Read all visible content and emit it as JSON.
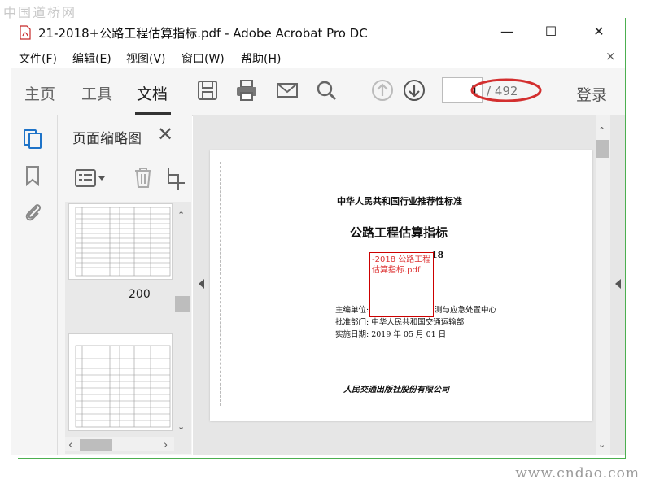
{
  "watermarks": {
    "top": "中国道桥网",
    "bottom": "www.cndao.com"
  },
  "window": {
    "title": "21-2018+公路工程估算指标.pdf - Adobe Acrobat Pro DC"
  },
  "window_buttons": {
    "minimize": "—",
    "maximize": "☐",
    "close": "✕"
  },
  "menu": {
    "items": [
      "文件(F)",
      "编辑(E)",
      "视图(V)",
      "窗口(W)",
      "帮助(H)"
    ],
    "close": "×"
  },
  "toolbar": {
    "tabs": [
      "主页",
      "工具",
      "文档"
    ],
    "active_tab": "文档",
    "icons": [
      "save-icon",
      "print-icon",
      "mail-icon",
      "search-icon",
      "arrow-up-icon",
      "arrow-down-icon"
    ],
    "page_current": "1",
    "page_total": "/ 492",
    "login": "登录",
    "highlight_color": "#d32f2f"
  },
  "left_rail": {
    "icons": [
      "page-thumbnails-icon",
      "bookmark-icon",
      "attachment-icon"
    ],
    "accent_color": "#1e73c8"
  },
  "thumbnail_panel": {
    "title": "页面缩略图",
    "close": "✕",
    "tools": [
      "options-icon",
      "delete-icon",
      "crop-icon"
    ],
    "thumb_label": "200"
  },
  "document": {
    "header": "中华人民共和国行业推荐性标准",
    "title": "公路工程估算指标",
    "code_fragment": "18",
    "annotation": "-2018 公路工程估算指标.pdf",
    "editor_label": "主编单位:",
    "editor_rest": "测与应急处置中心",
    "approver": "批准部门: 中华人民共和国交通运输部",
    "effective": "实施日期: 2019 年 05 月 01 日",
    "publisher": "人民交通出版社股份有限公司"
  }
}
